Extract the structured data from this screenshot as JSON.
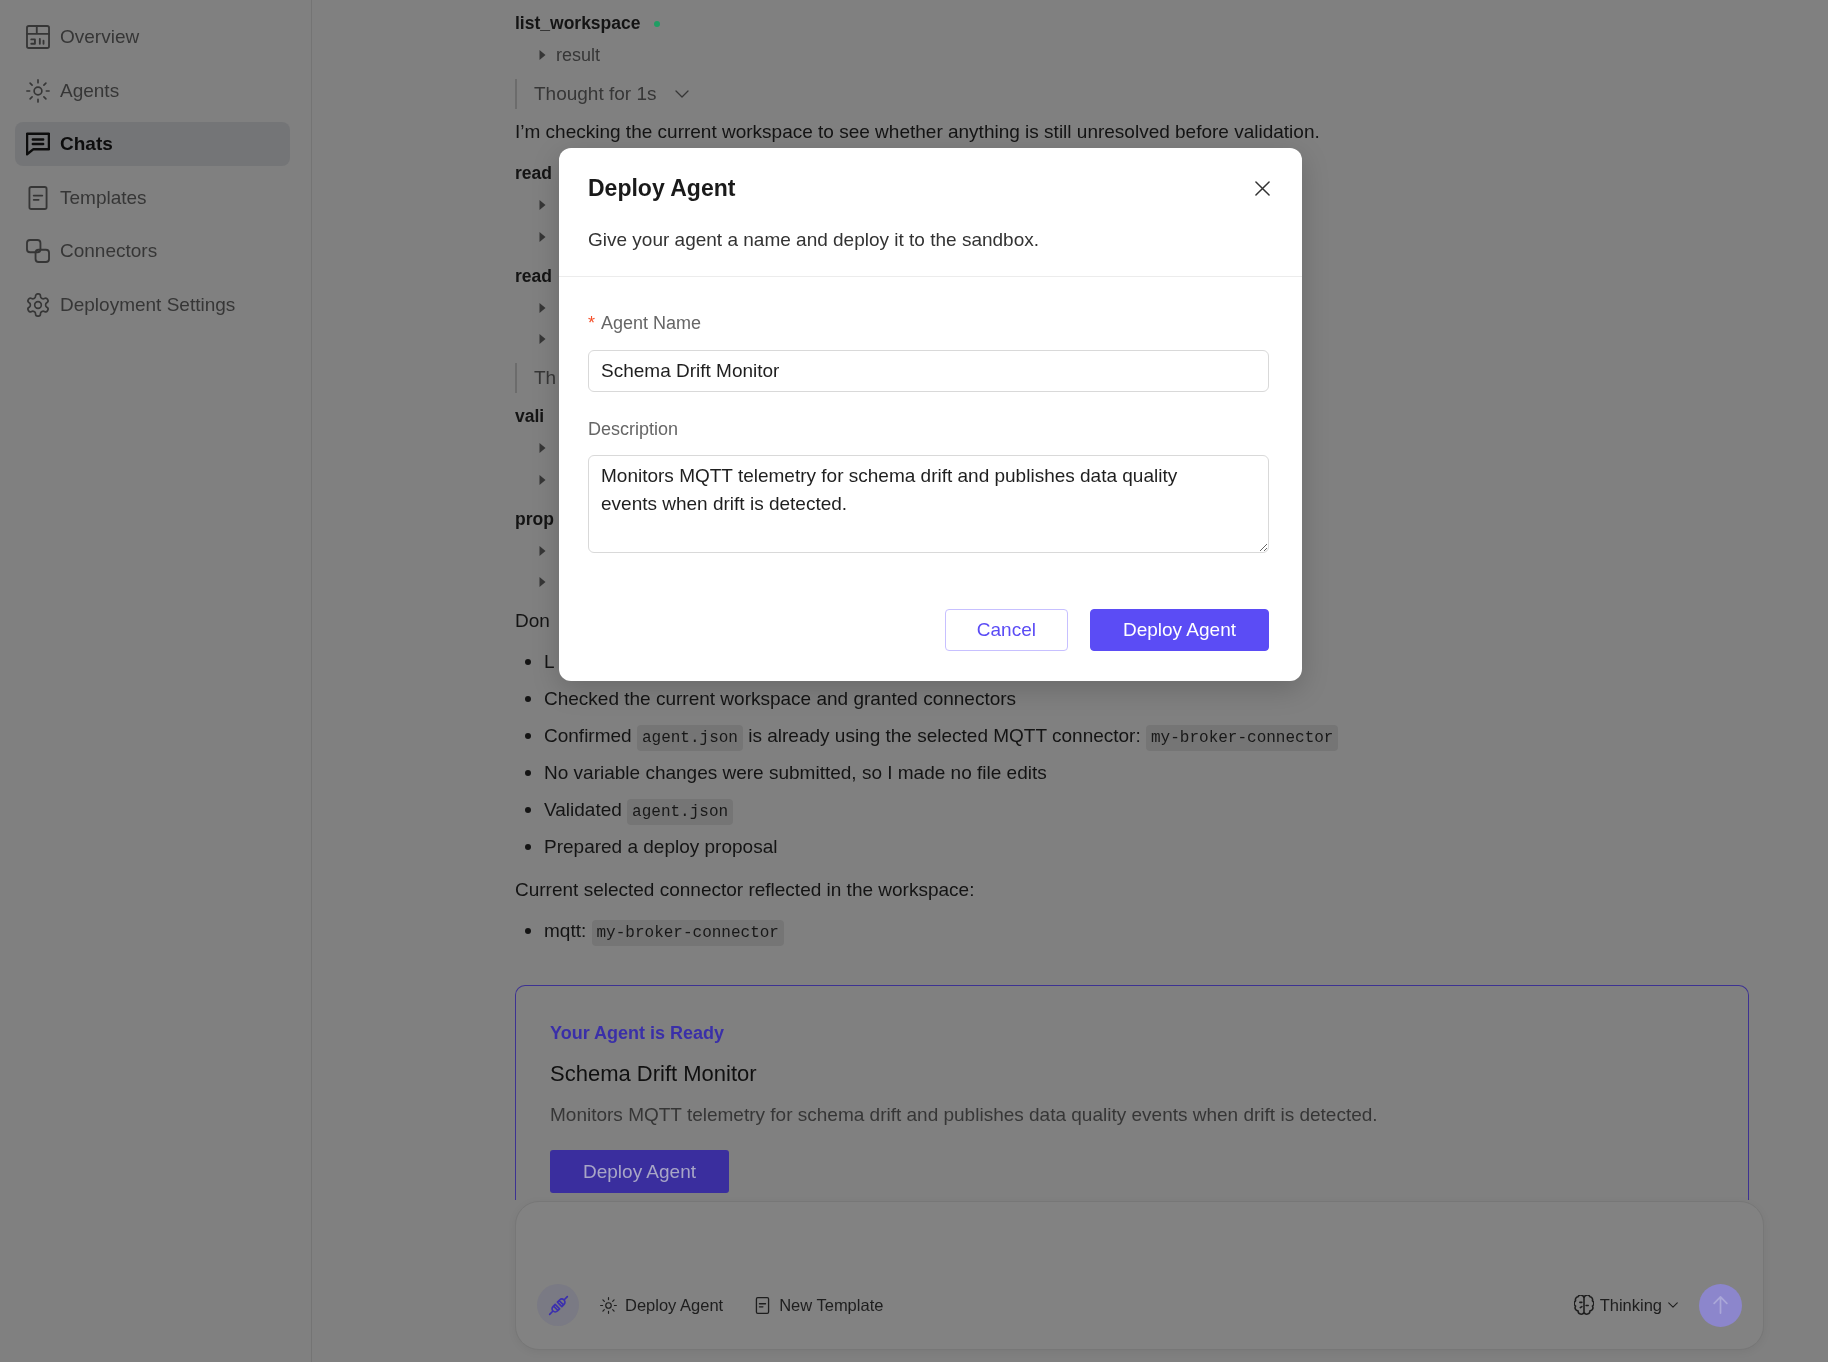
{
  "sidebar": {
    "items": [
      {
        "label": "Overview",
        "selected": false
      },
      {
        "label": "Agents",
        "selected": false
      },
      {
        "label": "Chats",
        "selected": true
      },
      {
        "label": "Templates",
        "selected": false
      },
      {
        "label": "Connectors",
        "selected": false
      },
      {
        "label": "Deployment Settings",
        "selected": false
      }
    ]
  },
  "chat": {
    "blocks": [
      {
        "kind": "tool",
        "name": "list_workspace",
        "color": "#1f9d63",
        "items": [
          {
            "label": "result",
            "expanded": false
          }
        ]
      },
      {
        "kind": "thought",
        "label": "Thought for 1s",
        "expanded": false
      },
      {
        "kind": "paragraph",
        "text": "I’m checking the current workspace to see whether anything is still unresolved before validation."
      },
      {
        "kind": "tool",
        "name": "read",
        "items": [
          {
            "expanded": false
          },
          {
            "expanded": false
          }
        ]
      },
      {
        "kind": "tool",
        "name": "read",
        "items": [
          {
            "expanded": false
          },
          {
            "expanded": false
          }
        ]
      },
      {
        "kind": "thought",
        "label": "Th"
      },
      {
        "kind": "tool",
        "name": "vali",
        "items": [
          {
            "expanded": false
          },
          {
            "expanded": false
          }
        ]
      },
      {
        "kind": "tool",
        "name": "prop",
        "items": [
          {
            "expanded": false
          },
          {
            "expanded": false
          }
        ]
      },
      {
        "kind": "paragraph",
        "text": "Don"
      },
      {
        "kind": "list",
        "items": [
          {
            "parts": [
              {
                "kind": "text",
                "text": "L"
              }
            ]
          },
          {
            "parts": [
              {
                "kind": "text",
                "text": "Checked the current workspace and granted connectors"
              }
            ]
          },
          {
            "parts": [
              {
                "kind": "text",
                "text": "Confirmed "
              },
              {
                "kind": "code",
                "text": "agent.json"
              },
              {
                "kind": "text",
                "text": " is already using the selected MQTT connector: "
              },
              {
                "kind": "code",
                "text": "my-broker-connector"
              }
            ]
          },
          {
            "parts": [
              {
                "kind": "text",
                "text": "No variable changes were submitted, so I made no file edits"
              }
            ]
          },
          {
            "parts": [
              {
                "kind": "text",
                "text": "Validated "
              },
              {
                "kind": "code",
                "text": "agent.json"
              }
            ]
          },
          {
            "parts": [
              {
                "kind": "text",
                "text": "Prepared a deploy proposal"
              }
            ]
          }
        ]
      },
      {
        "kind": "paragraph",
        "text": "Current selected connector reflected in the workspace:"
      },
      {
        "kind": "list",
        "items": [
          {
            "parts": [
              {
                "kind": "text",
                "text": "mqtt: "
              },
              {
                "kind": "code",
                "text": "my-broker-connector"
              }
            ]
          }
        ]
      }
    ]
  },
  "agent_card": {
    "eyebrow": "Your Agent is Ready",
    "name": "Schema Drift Monitor",
    "description": "Monitors MQTT telemetry for schema drift and publishes data quality events when drift is detected.",
    "button": "Deploy Agent"
  },
  "composer": {
    "actions": [
      {
        "label": "Deploy Agent"
      },
      {
        "label": "New Template"
      }
    ],
    "mode": {
      "label": "Thinking"
    },
    "send_button": {
      "disabled": true
    }
  },
  "dialog": {
    "title": "Deploy Agent",
    "subtitle": "Give your agent a name and deploy it to the sandbox.",
    "fields": [
      {
        "kind": "input",
        "label": "Agent Name",
        "required_mark": "*",
        "value": "Schema Drift Monitor"
      },
      {
        "kind": "textarea",
        "label": "Description",
        "value": "Monitors MQTT telemetry for schema drift and publishes data quality events when drift is detected."
      }
    ],
    "buttons": [
      {
        "kind": "secondary",
        "label": "Cancel"
      },
      {
        "kind": "primary",
        "label": "Deploy Agent"
      }
    ]
  }
}
